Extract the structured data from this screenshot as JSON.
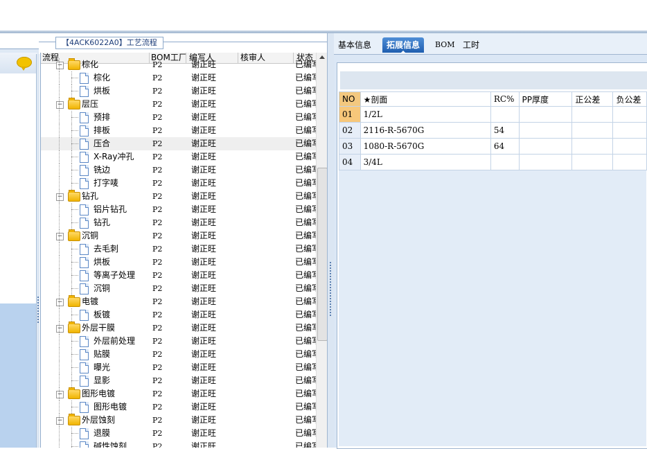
{
  "tree_panel": {
    "title": "【4ACK6022A0】工艺流程",
    "columns": [
      "流程",
      "BOM工厂",
      "编写人",
      "核审人",
      "状态"
    ],
    "rows": [
      {
        "level": 0,
        "type": "folder",
        "label": "棕化",
        "bom": "P2",
        "author": "谢正旺",
        "status": "已编写"
      },
      {
        "level": 1,
        "type": "doc",
        "label": "棕化",
        "bom": "P2",
        "author": "谢正旺",
        "status": "已编写"
      },
      {
        "level": 1,
        "type": "doc",
        "label": "烘板",
        "bom": "P2",
        "author": "谢正旺",
        "status": "已编写"
      },
      {
        "level": 0,
        "type": "folder",
        "label": "层压",
        "bom": "P2",
        "author": "谢正旺",
        "status": "已编写"
      },
      {
        "level": 1,
        "type": "doc",
        "label": "预排",
        "bom": "P2",
        "author": "谢正旺",
        "status": "已编写"
      },
      {
        "level": 1,
        "type": "doc",
        "label": "排板",
        "bom": "P2",
        "author": "谢正旺",
        "status": "已编写"
      },
      {
        "level": 1,
        "type": "doc",
        "label": "压合",
        "bom": "P2",
        "author": "谢正旺",
        "status": "已编写",
        "selected": true
      },
      {
        "level": 1,
        "type": "doc",
        "label": "X-Ray冲孔",
        "bom": "P2",
        "author": "谢正旺",
        "status": "已编写"
      },
      {
        "level": 1,
        "type": "doc",
        "label": "铣边",
        "bom": "P2",
        "author": "谢正旺",
        "status": "已编写"
      },
      {
        "level": 1,
        "type": "doc",
        "label": "打字唛",
        "bom": "P2",
        "author": "谢正旺",
        "status": "已编写"
      },
      {
        "level": 0,
        "type": "folder",
        "label": "钻孔",
        "bom": "P2",
        "author": "谢正旺",
        "status": "已编写"
      },
      {
        "level": 1,
        "type": "doc",
        "label": "铝片钻孔",
        "bom": "P2",
        "author": "谢正旺",
        "status": "已编写"
      },
      {
        "level": 1,
        "type": "doc",
        "label": "钻孔",
        "bom": "P2",
        "author": "谢正旺",
        "status": "已编写"
      },
      {
        "level": 0,
        "type": "folder",
        "label": "沉铜",
        "bom": "P2",
        "author": "谢正旺",
        "status": "已编写"
      },
      {
        "level": 1,
        "type": "doc",
        "label": "去毛刺",
        "bom": "P2",
        "author": "谢正旺",
        "status": "已编写"
      },
      {
        "level": 1,
        "type": "doc",
        "label": "烘板",
        "bom": "P2",
        "author": "谢正旺",
        "status": "已编写"
      },
      {
        "level": 1,
        "type": "doc",
        "label": "等离子处理",
        "bom": "P2",
        "author": "谢正旺",
        "status": "已编写"
      },
      {
        "level": 1,
        "type": "doc",
        "label": "沉铜",
        "bom": "P2",
        "author": "谢正旺",
        "status": "已编写"
      },
      {
        "level": 0,
        "type": "folder",
        "label": "电镀",
        "bom": "P2",
        "author": "谢正旺",
        "status": "已编写"
      },
      {
        "level": 1,
        "type": "doc",
        "label": "板镀",
        "bom": "P2",
        "author": "谢正旺",
        "status": "已编写"
      },
      {
        "level": 0,
        "type": "folder",
        "label": "外层干膜",
        "bom": "P2",
        "author": "谢正旺",
        "status": "已编写"
      },
      {
        "level": 1,
        "type": "doc",
        "label": "外层前处理",
        "bom": "P2",
        "author": "谢正旺",
        "status": "已编写"
      },
      {
        "level": 1,
        "type": "doc",
        "label": "贴膜",
        "bom": "P2",
        "author": "谢正旺",
        "status": "已编写"
      },
      {
        "level": 1,
        "type": "doc",
        "label": "曝光",
        "bom": "P2",
        "author": "谢正旺",
        "status": "已编写"
      },
      {
        "level": 1,
        "type": "doc",
        "label": "显影",
        "bom": "P2",
        "author": "谢正旺",
        "status": "已编写"
      },
      {
        "level": 0,
        "type": "folder",
        "label": "图形电镀",
        "bom": "P2",
        "author": "谢正旺",
        "status": "已编写"
      },
      {
        "level": 1,
        "type": "doc",
        "label": "图形电镀",
        "bom": "P2",
        "author": "谢正旺",
        "status": "已编写"
      },
      {
        "level": 0,
        "type": "folder",
        "label": "外层蚀刻",
        "bom": "P2",
        "author": "谢正旺",
        "status": "已编写"
      },
      {
        "level": 1,
        "type": "doc",
        "label": "退膜",
        "bom": "P2",
        "author": "谢正旺",
        "status": "已编写"
      },
      {
        "level": 1,
        "type": "doc",
        "label": "碱性蚀刻",
        "bom": "P2",
        "author": "谢正旺",
        "status": "已编写"
      }
    ]
  },
  "right_panel": {
    "tabs": [
      {
        "label": "基本信息",
        "active": false
      },
      {
        "label": "拓展信息",
        "active": true
      },
      {
        "label": "BOM",
        "active": false
      },
      {
        "label": "工时",
        "active": false
      }
    ],
    "grid": {
      "columns": [
        "NO",
        "★剖面",
        "RC%",
        "PP厚度",
        "正公差",
        "负公差"
      ],
      "rows": [
        {
          "no": "01",
          "section": "1/2L",
          "rc": "",
          "pp": "",
          "pos": "",
          "neg": "",
          "current": true
        },
        {
          "no": "02",
          "section": "2116-R-5670G",
          "rc": "54",
          "pp": "",
          "pos": "",
          "neg": ""
        },
        {
          "no": "03",
          "section": "1080-R-5670G",
          "rc": "64",
          "pp": "",
          "pos": "",
          "neg": ""
        },
        {
          "no": "04",
          "section": "3/4L",
          "rc": "",
          "pp": "",
          "pos": "",
          "neg": ""
        }
      ]
    }
  },
  "icons": {
    "chat": "speech-bubble-icon",
    "folder": "folder-icon",
    "doc": "document-icon"
  },
  "colors": {
    "active_tab": "#2a6cc0",
    "current_row_marker": "#f7c77a",
    "panel_bg": "#dbe7f5"
  }
}
